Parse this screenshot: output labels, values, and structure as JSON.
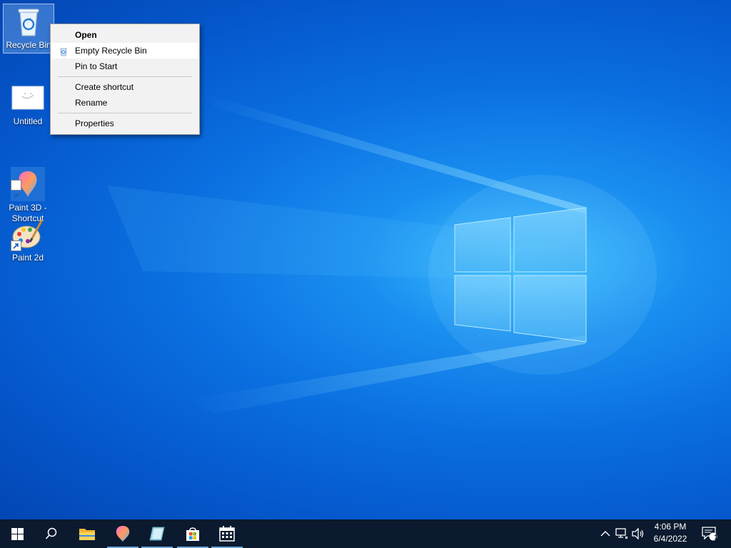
{
  "desktop": {
    "icons": [
      {
        "label": "Recycle Bin"
      },
      {
        "label": "Untitled"
      },
      {
        "label": "Paint 3D -\nShortcut"
      },
      {
        "label": "Paint 2d"
      }
    ]
  },
  "context_menu": {
    "items": [
      {
        "label": "Open"
      },
      {
        "label": "Empty Recycle Bin"
      },
      {
        "label": "Pin to Start"
      },
      {
        "label": "Create shortcut"
      },
      {
        "label": "Rename"
      },
      {
        "label": "Properties"
      }
    ]
  },
  "taskbar": {
    "apps": [
      {
        "icon": "windows-start-icon"
      },
      {
        "icon": "search-icon"
      },
      {
        "icon": "file-explorer-icon"
      },
      {
        "icon": "paint-3d-icon"
      },
      {
        "icon": "paint-book-icon"
      },
      {
        "icon": "microsoft-store-icon"
      },
      {
        "icon": "calendar-icon"
      }
    ],
    "tray": {
      "time": "4:06 PM",
      "date": "6/4/2022",
      "notification_count": "1"
    }
  },
  "colors": {
    "taskbar_bg": "#0b1a2e",
    "accent": "#6fa7d9",
    "menu_bg": "#f2f2f2"
  }
}
